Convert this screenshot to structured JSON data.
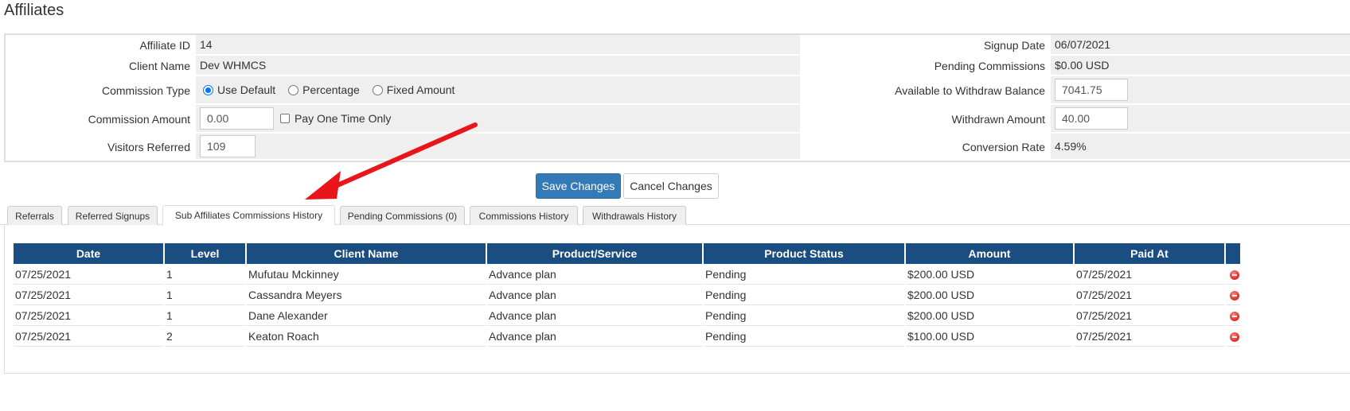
{
  "page": {
    "title": "Affiliates"
  },
  "affiliate": {
    "id_label": "Affiliate ID",
    "id": "14",
    "client_label": "Client Name",
    "client": "Dev WHMCS",
    "commission_type_label": "Commission Type",
    "commission_type_options": [
      "Use Default",
      "Percentage",
      "Fixed Amount"
    ],
    "commission_type_selected": "Use Default",
    "commission_amount_label": "Commission Amount",
    "commission_amount": "0.00",
    "pay_one_time_label": "Pay One Time Only",
    "visitors_label": "Visitors Referred",
    "visitors": "109",
    "signup_label": "Signup Date",
    "signup": "06/07/2021",
    "pending_label": "Pending Commissions",
    "pending": "$0.00 USD",
    "balance_label": "Available to Withdraw Balance",
    "balance": "7041.75",
    "withdrawn_label": "Withdrawn Amount",
    "withdrawn": "40.00",
    "conversion_label": "Conversion Rate",
    "conversion": "4.59%"
  },
  "actions": {
    "save": "Save Changes",
    "cancel": "Cancel Changes"
  },
  "tabs": [
    {
      "label": "Referrals"
    },
    {
      "label": "Referred Signups"
    },
    {
      "label": "Sub Affiliates Commissions History"
    },
    {
      "label": "Pending Commissions (0)"
    },
    {
      "label": "Commissions History"
    },
    {
      "label": "Withdrawals History"
    }
  ],
  "active_tab": "Sub Affiliates Commissions History",
  "table": {
    "headers": [
      "Date",
      "Level",
      "Client Name",
      "Product/Service",
      "Product Status",
      "Amount",
      "Paid At"
    ],
    "rows": [
      [
        "07/25/2021",
        "1",
        "Mufutau Mckinney",
        "Advance plan",
        "Pending",
        "$200.00 USD",
        "07/25/2021"
      ],
      [
        "07/25/2021",
        "1",
        "Cassandra Meyers",
        "Advance plan",
        "Pending",
        "$200.00 USD",
        "07/25/2021"
      ],
      [
        "07/25/2021",
        "1",
        "Dane Alexander",
        "Advance plan",
        "Pending",
        "$200.00 USD",
        "07/25/2021"
      ],
      [
        "07/25/2021",
        "2",
        "Keaton Roach",
        "Advance plan",
        "Pending",
        "$100.00 USD",
        "07/25/2021"
      ]
    ]
  },
  "colors": {
    "primary": "#337ab7",
    "table_header": "#1a4d80",
    "arrow": "#e8151b"
  }
}
